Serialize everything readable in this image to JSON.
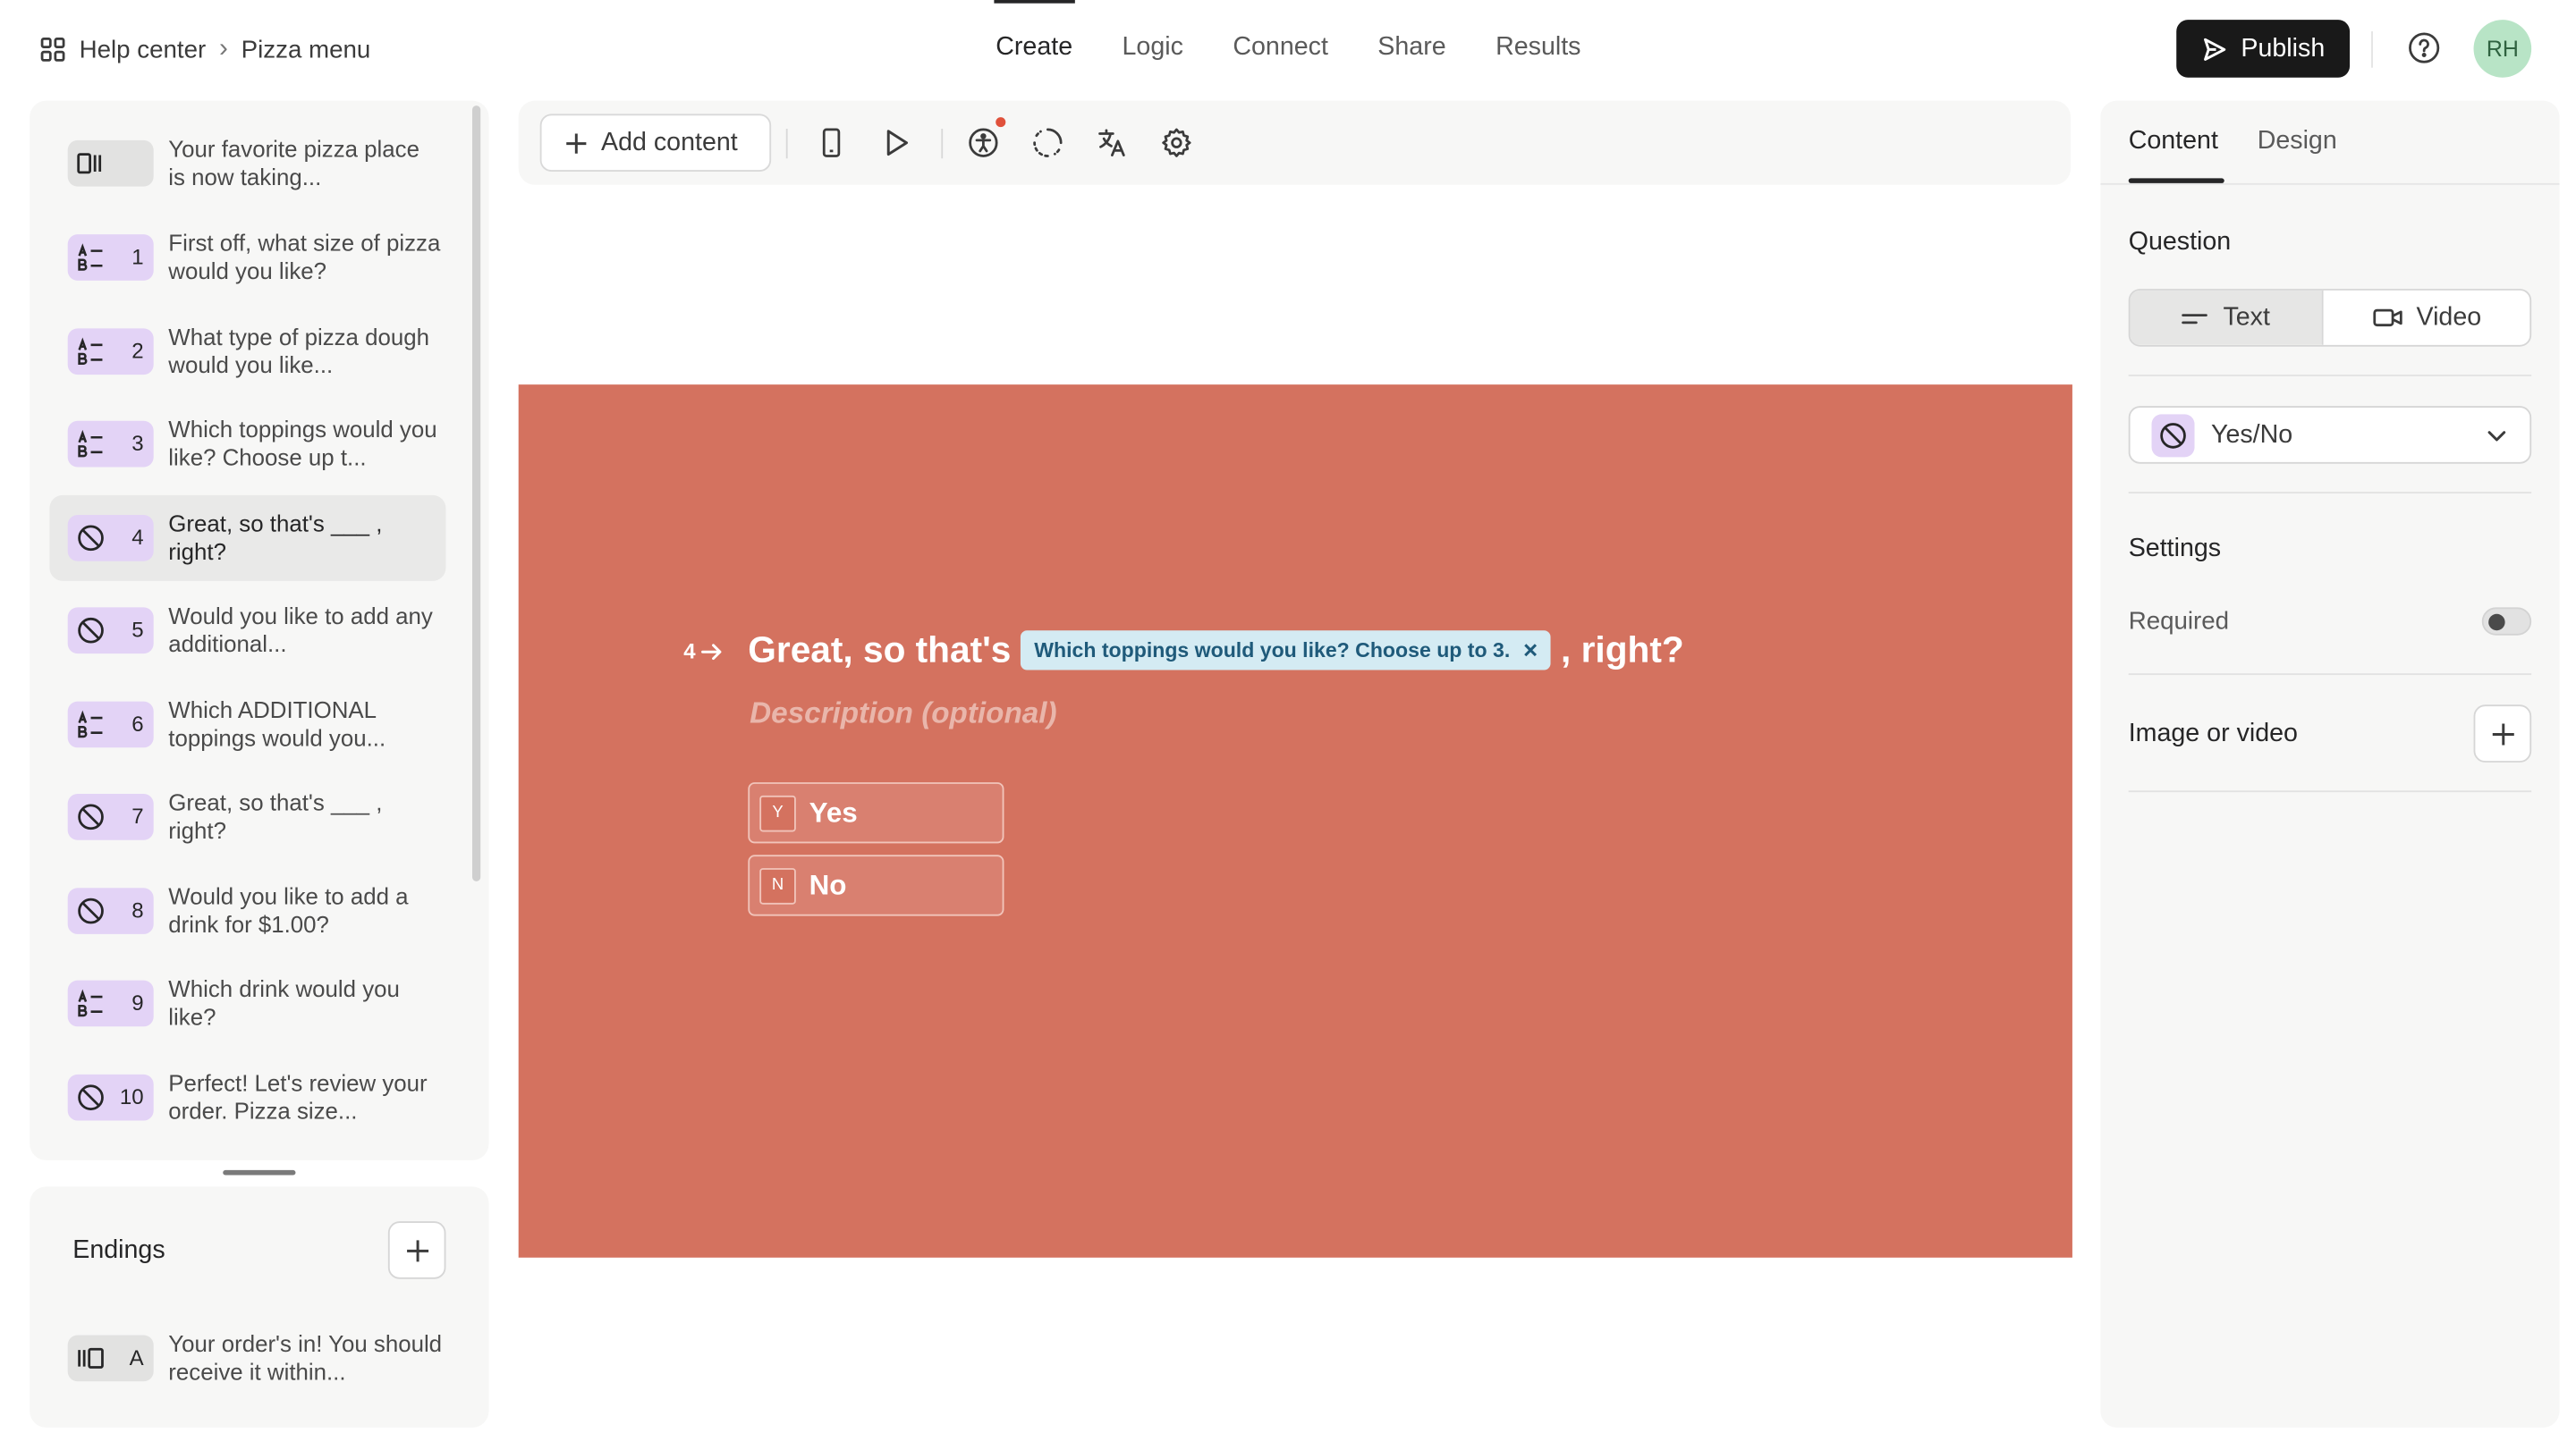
{
  "breadcrumb": {
    "root": "Help center",
    "separator": "›",
    "current": "Pizza menu"
  },
  "nav": {
    "tabs": [
      {
        "label": "Create",
        "active": true
      },
      {
        "label": "Logic",
        "active": false
      },
      {
        "label": "Connect",
        "active": false
      },
      {
        "label": "Share",
        "active": false
      },
      {
        "label": "Results",
        "active": false
      }
    ]
  },
  "header": {
    "publish_label": "Publish",
    "avatar_initials": "RH"
  },
  "toolbar": {
    "add_content_label": "Add content"
  },
  "questions": [
    {
      "number": "",
      "type": "statement",
      "text": "Your favorite pizza place is now taking...",
      "selected": false
    },
    {
      "number": "1",
      "type": "multiple-choice",
      "text": "First off, what size of pizza would you like?",
      "selected": false
    },
    {
      "number": "2",
      "type": "multiple-choice",
      "text": "What type of pizza dough would you like...",
      "selected": false
    },
    {
      "number": "3",
      "type": "multiple-choice",
      "text": "Which toppings would you like? Choose up t...",
      "selected": false
    },
    {
      "number": "4",
      "type": "yes-no",
      "text": "Great, so that's ___ , right?",
      "selected": true
    },
    {
      "number": "5",
      "type": "yes-no",
      "text": "Would you like to add any additional...",
      "selected": false
    },
    {
      "number": "6",
      "type": "multiple-choice",
      "text": "Which ADDITIONAL toppings would you...",
      "selected": false
    },
    {
      "number": "7",
      "type": "yes-no",
      "text": "Great, so that's ___ , right?",
      "selected": false
    },
    {
      "number": "8",
      "type": "yes-no",
      "text": "Would you like to add a drink for $1.00?",
      "selected": false
    },
    {
      "number": "9",
      "type": "multiple-choice",
      "text": "Which drink would you like?",
      "selected": false
    },
    {
      "number": "10",
      "type": "yes-no",
      "text": "Perfect! Let's review your order. Pizza size...",
      "selected": false
    }
  ],
  "endings": {
    "title": "Endings",
    "items": [
      {
        "letter": "A",
        "text": "Your order's in! You should receive it within..."
      }
    ]
  },
  "canvas": {
    "background": "#d4725f",
    "question_number": "4",
    "title_prefix": "Great, so that's",
    "recall_tag": "Which toppings would you like? Choose up to 3.",
    "recall_remove": "×",
    "title_suffix": ", right?",
    "description_placeholder": "Description (optional)",
    "choices": [
      {
        "key": "Y",
        "label": "Yes"
      },
      {
        "key": "N",
        "label": "No"
      }
    ]
  },
  "right_panel": {
    "tabs": [
      {
        "label": "Content",
        "active": true
      },
      {
        "label": "Design",
        "active": false
      }
    ],
    "question_section": "Question",
    "question_modes": [
      {
        "label": "Text",
        "active": true
      },
      {
        "label": "Video",
        "active": false
      }
    ],
    "question_type": "Yes/No",
    "settings_section": "Settings",
    "required_label": "Required",
    "required_on": false,
    "image_video_label": "Image or video"
  },
  "colors": {
    "accent_dark": "#191919",
    "purple_badge": "#e3d3f6",
    "recall_bg": "#d4ebf3",
    "avatar_bg": "#b8e4c6"
  }
}
